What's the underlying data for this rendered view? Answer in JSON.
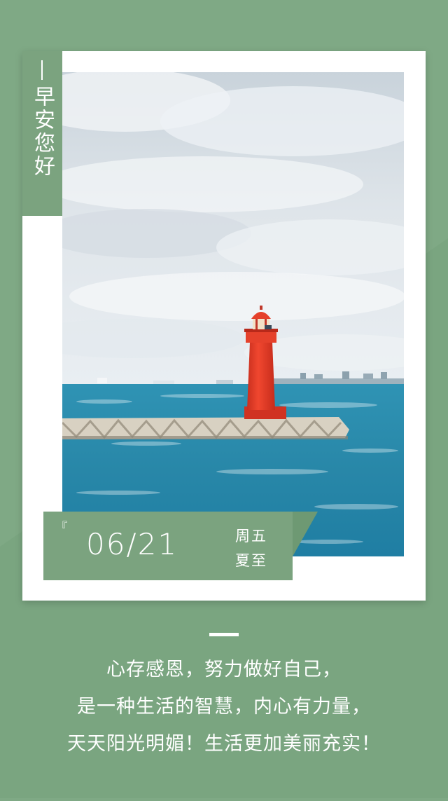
{
  "side_label": "早安您好",
  "date": {
    "quote_mark": "『",
    "date_text": "06/21",
    "weekday": "周五",
    "solar_term": "夏至"
  },
  "quote": {
    "line1": "心存感恩，努力做好自己，",
    "line2": "是一种生活的智慧，内心有力量，",
    "line3": "天天阳光明媚！生活更加美丽充实！"
  },
  "colors": {
    "background": "#7fa985",
    "accent": "#7ba37f",
    "lighthouse": "#e8402c",
    "sea": "#2a8aab"
  },
  "photo": {
    "subject": "lighthouse-icon"
  }
}
